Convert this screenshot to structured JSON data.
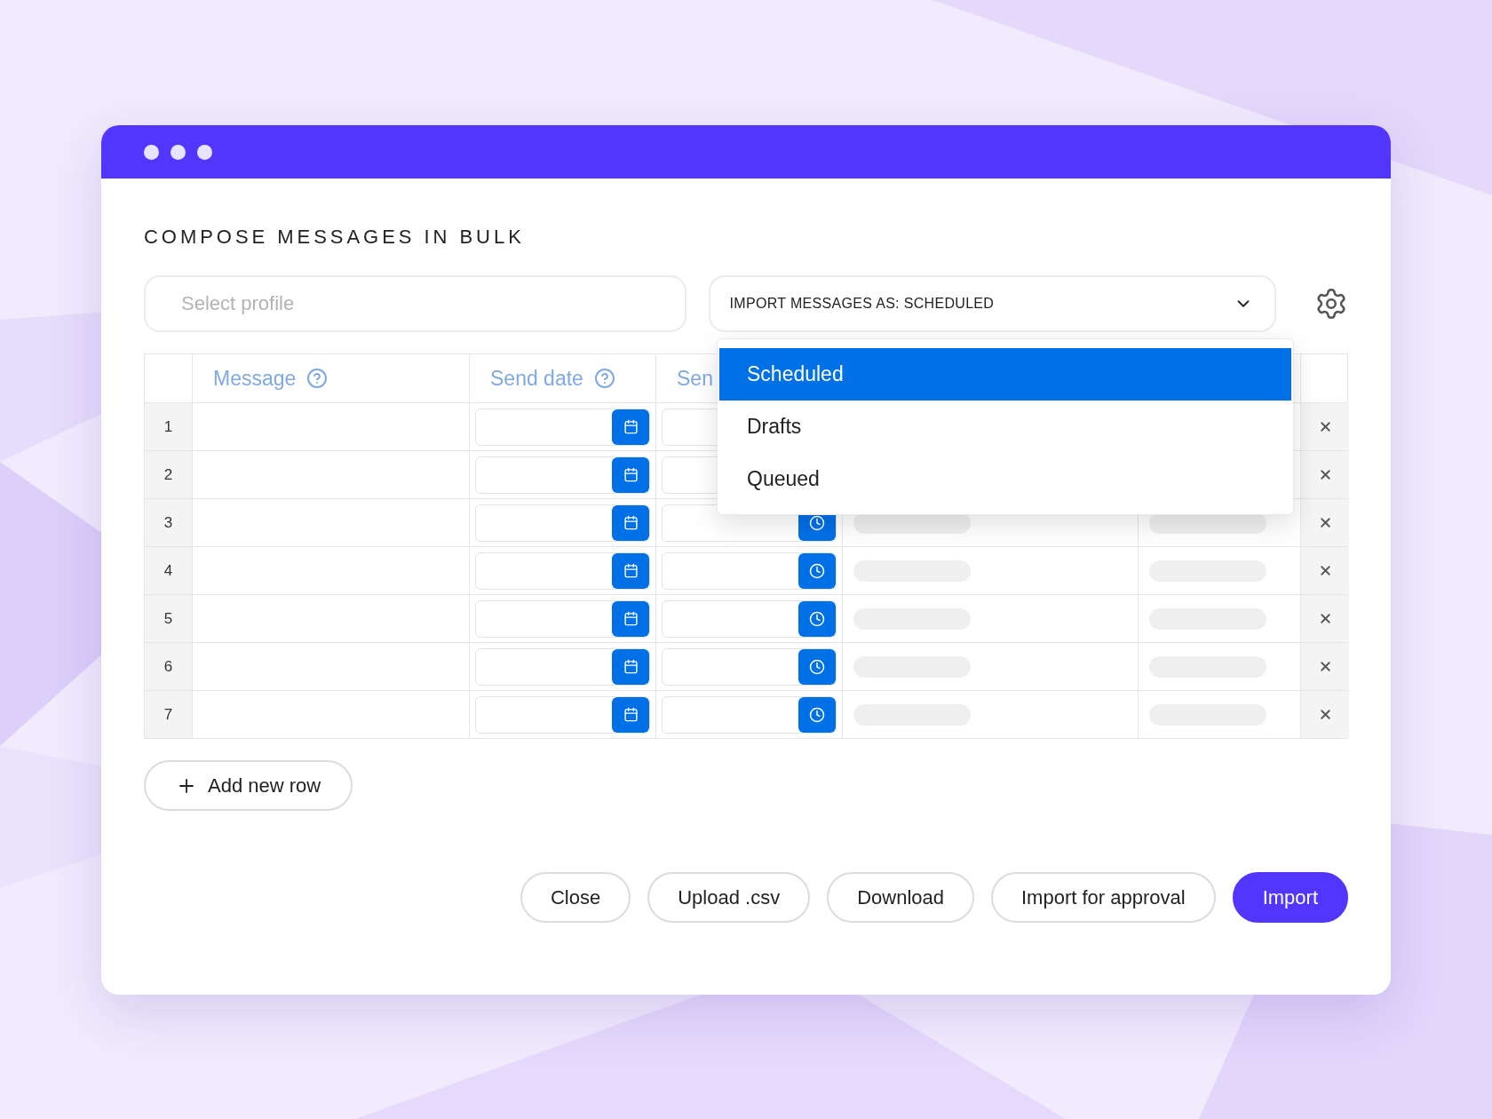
{
  "window": {
    "title": "COMPOSE MESSAGES IN BULK"
  },
  "profile_field": {
    "placeholder": "Select profile"
  },
  "import_select": {
    "value": "IMPORT MESSAGES AS: SCHEDULED",
    "expanded": true,
    "options": [
      {
        "label": "Scheduled",
        "selected": true
      },
      {
        "label": "Drafts",
        "selected": false
      },
      {
        "label": "Queued",
        "selected": false
      }
    ]
  },
  "table": {
    "columns": [
      {
        "label": "Message",
        "help": true
      },
      {
        "label": "Send date",
        "help": true
      },
      {
        "label": "Sen"
      }
    ],
    "rows": [
      {
        "number": "1"
      },
      {
        "number": "2"
      },
      {
        "number": "3"
      },
      {
        "number": "4"
      },
      {
        "number": "5"
      },
      {
        "number": "6"
      },
      {
        "number": "7"
      }
    ]
  },
  "add_row": "Add new row",
  "buttons": [
    {
      "label": "Close",
      "kind": "secondary"
    },
    {
      "label": "Upload .csv",
      "kind": "secondary"
    },
    {
      "label": "Download",
      "kind": "secondary"
    },
    {
      "label": "Import for approval",
      "kind": "secondary"
    },
    {
      "label": "Import",
      "kind": "primary"
    }
  ]
}
